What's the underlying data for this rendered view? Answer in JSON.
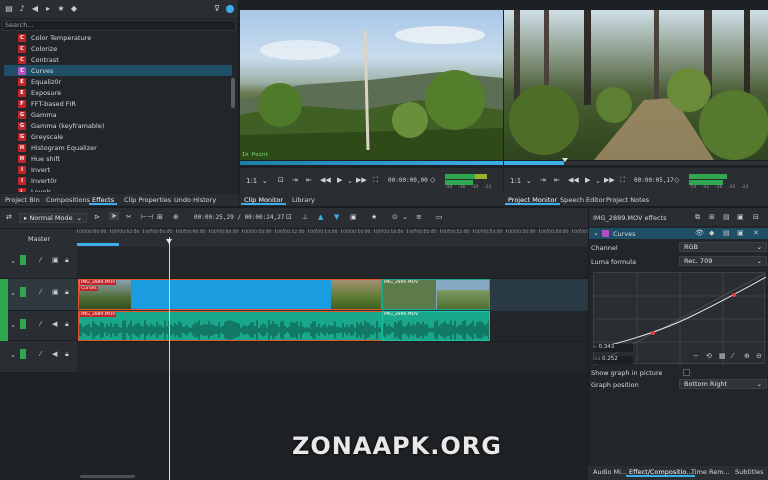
{
  "effects_panel": {
    "search_placeholder": "Search...",
    "items": [
      {
        "label": "Color Temperature",
        "badge": "C"
      },
      {
        "label": "Colorize",
        "badge": "C"
      },
      {
        "label": "Contrast",
        "badge": "C"
      },
      {
        "label": "Curves",
        "badge": "C",
        "selected": true
      },
      {
        "label": "Equaliz0r",
        "badge": "E"
      },
      {
        "label": "Exposure",
        "badge": "E"
      },
      {
        "label": "FFT-based FIR",
        "badge": "F"
      },
      {
        "label": "Gamma",
        "badge": "G"
      },
      {
        "label": "Gamma (keyframable)",
        "badge": "G"
      },
      {
        "label": "Greyscale",
        "badge": "G"
      },
      {
        "label": "Histogram Equalizer",
        "badge": "H"
      },
      {
        "label": "Hue shift",
        "badge": "H"
      },
      {
        "label": "Invert",
        "badge": "I"
      },
      {
        "label": "Invert0r",
        "badge": "I"
      },
      {
        "label": "Levels",
        "badge": "L"
      }
    ]
  },
  "left_tabs": [
    "Project Bin",
    "Compositions",
    "Effects",
    "Clip Properties",
    "Undo History"
  ],
  "left_active_tab": "Effects",
  "clip_monitor": {
    "in_point_label": "In Point",
    "zoom": "1:1",
    "timecode": "00:00:00,00",
    "meter_labels": [
      "-48",
      "-36",
      "-30",
      "-24"
    ],
    "tabs": [
      "Clip Monitor",
      "Library"
    ],
    "active_tab": "Clip Monitor"
  },
  "project_monitor": {
    "zoom": "1:1",
    "timecode": "00:00:05,17",
    "meter_labels": [
      "-54",
      "-42",
      "-36",
      "-30",
      "-24"
    ],
    "tabs": [
      "Project Monitor",
      "Speech Editor",
      "Project Notes"
    ],
    "active_tab": "Project Monitor"
  },
  "timeline_toolbar": {
    "mode": "Normal Mode",
    "timecode": "00:00:25,29 / 00:00:24,27"
  },
  "timeline": {
    "master_label": "Master",
    "ruler": [
      "00:00:00:00",
      "00:00:02:00",
      "00:00:04:00",
      "00:00:06:00",
      "00:00:08:00",
      "00:00:10:00",
      "00:00:12:00",
      "00:00:14:00",
      "00:00:16:00",
      "00:00:18:00",
      "00:00:20:00",
      "00:00:22:00",
      "00:00:24:00",
      "00:00:26:00",
      "00:00:28:00",
      "00:00:30:00"
    ],
    "video_clip_a": "IMG_2889.MOV",
    "video_clip_a_sub": "Curves",
    "video_clip_b": "IMG_2890.MOV",
    "audio_clip_a": "IMG_2889.MOV",
    "audio_clip_b": "IMG_2890.MOV"
  },
  "effect_stack": {
    "title": "IMG_2889.MOV effects",
    "effect_name": "Curves",
    "channel_label": "Channel",
    "channel_value": "RGB",
    "luma_label": "Luma formula",
    "luma_value": "Rec. 709",
    "in_label": "In",
    "in_value": "0.343",
    "out_label": "Out",
    "out_value": "0.252",
    "show_graph_label": "Show graph in picture",
    "graph_position_label": "Graph position",
    "graph_position_value": "Bottom Right"
  },
  "right_bottom_tabs": [
    "Audio Mi...",
    "Effect/Compositio...",
    "Time Rem...",
    "Subtitles"
  ],
  "right_bottom_active": "Effect/Compositio...",
  "watermark": "ZONAAPK.ORG",
  "colors": {
    "accent": "#3daee9",
    "clip_blue": "#1a9de0",
    "audio_teal": "#1aa88c",
    "video_orange": "#e0582a"
  }
}
